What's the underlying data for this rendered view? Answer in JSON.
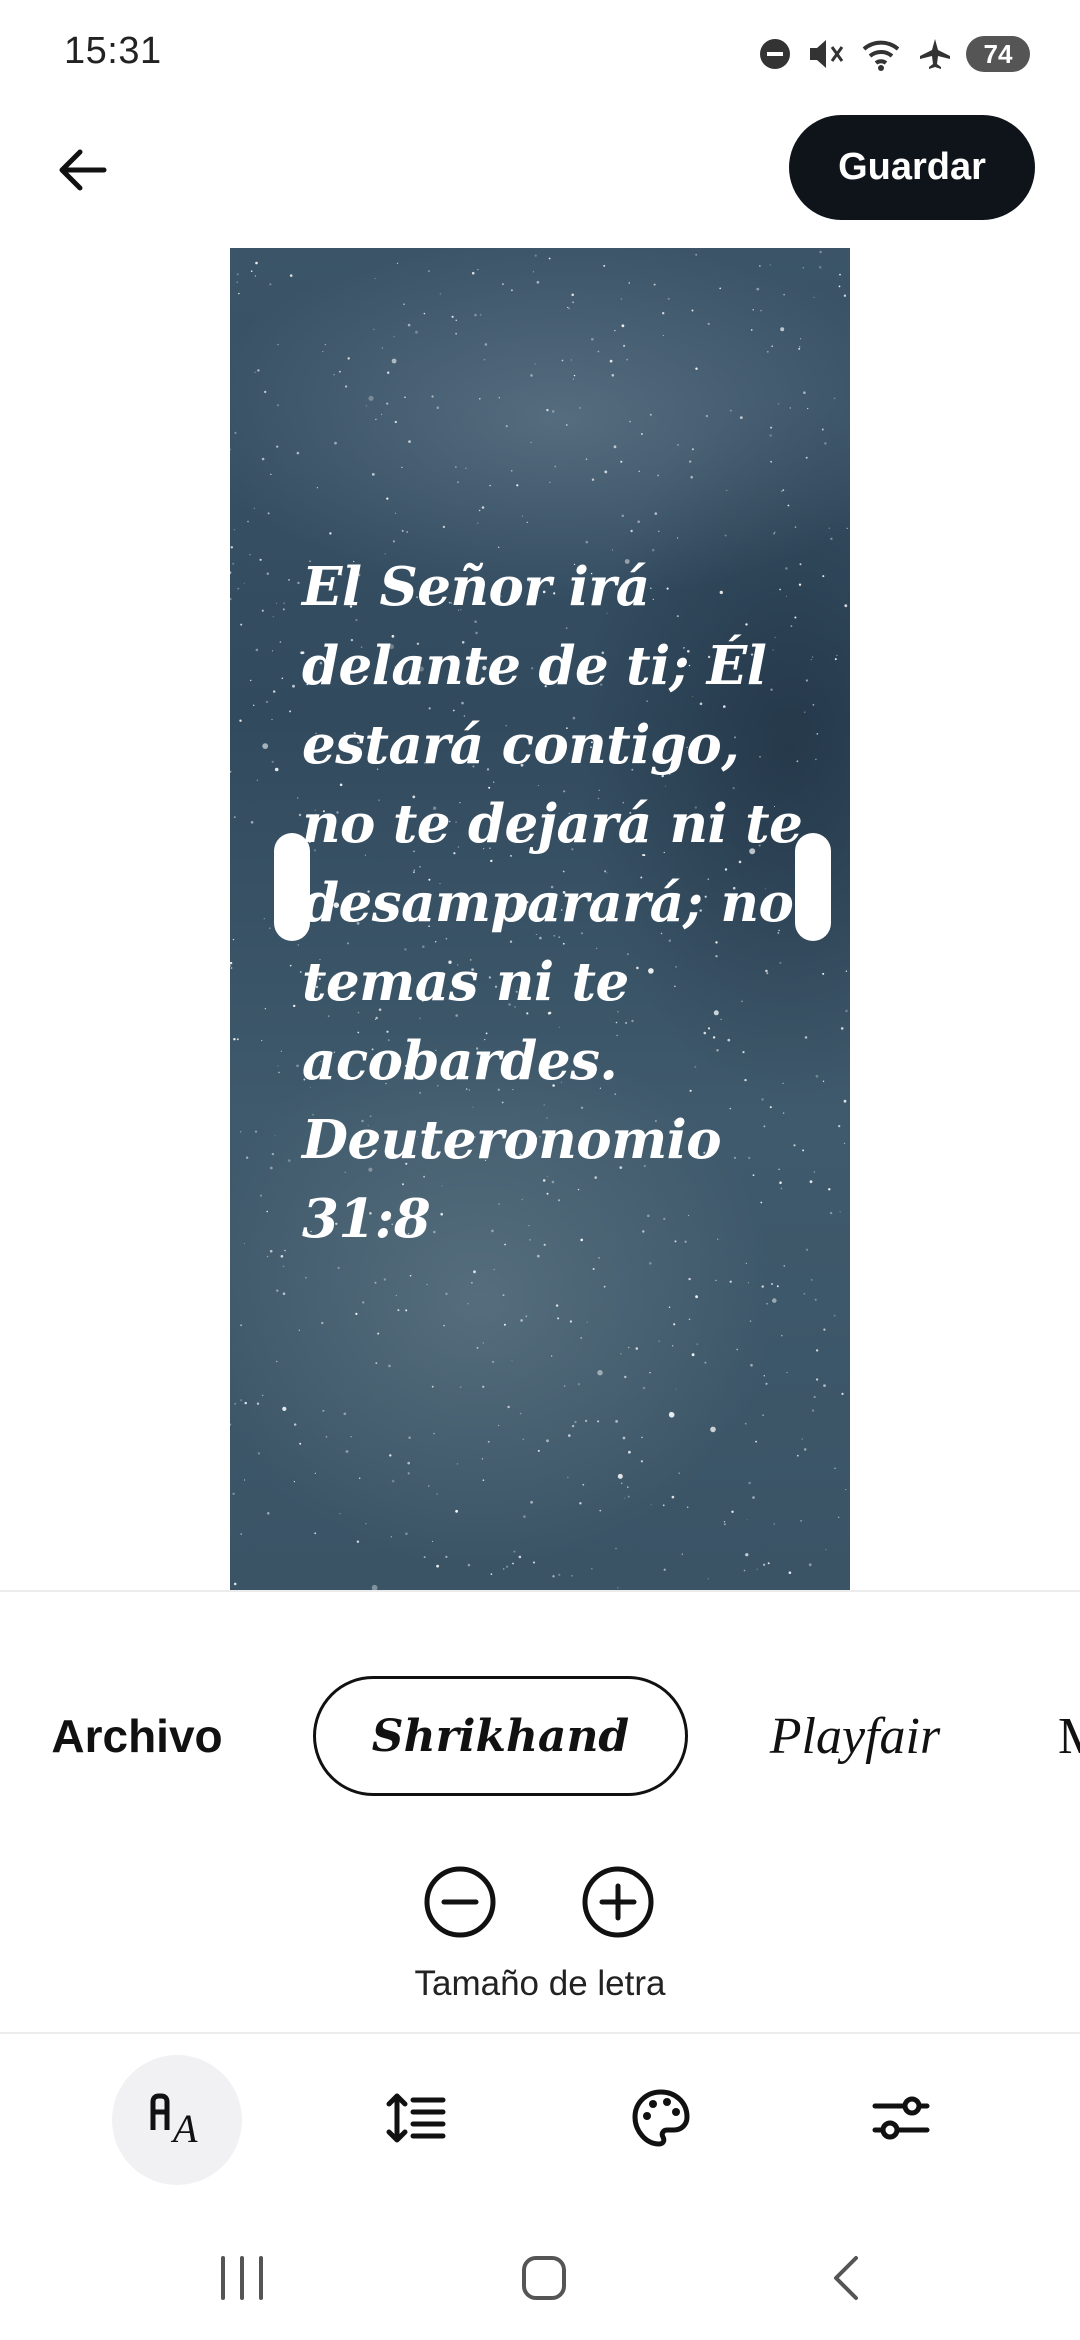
{
  "status_bar": {
    "time": "15:31",
    "battery": "74",
    "icons": [
      "do-not-disturb-icon",
      "mute-icon",
      "wifi-icon",
      "airplane-icon",
      "battery-icon"
    ]
  },
  "toolbar": {
    "back_icon": "arrow-left-icon",
    "save_label": "Guardar"
  },
  "preview": {
    "verse_text": "El Señor irá delante de ti; Él estará contigo, no te dejará ni te desamparará; no temas ni te acobardes. Deuteronomio 31:8",
    "background": "starry-night-sky"
  },
  "fonts": {
    "options": [
      "Archivo",
      "Shrikhand",
      "Playfair",
      "M"
    ],
    "selected": "Shrikhand"
  },
  "font_size": {
    "label": "Tamaño de letra",
    "decrease_icon": "minus-circle-icon",
    "increase_icon": "plus-circle-icon"
  },
  "bottom_tools": [
    "text-style-icon",
    "line-spacing-icon",
    "palette-icon",
    "sliders-icon"
  ],
  "active_tool": "text-style-icon",
  "nav_bar": [
    "recents-icon",
    "home-icon",
    "back-icon"
  ],
  "colors": {
    "primary": "#0f131a",
    "background": "#ffffff",
    "preview_bg": "#3b5468",
    "active_tool_bg": "#f1f1f3"
  }
}
